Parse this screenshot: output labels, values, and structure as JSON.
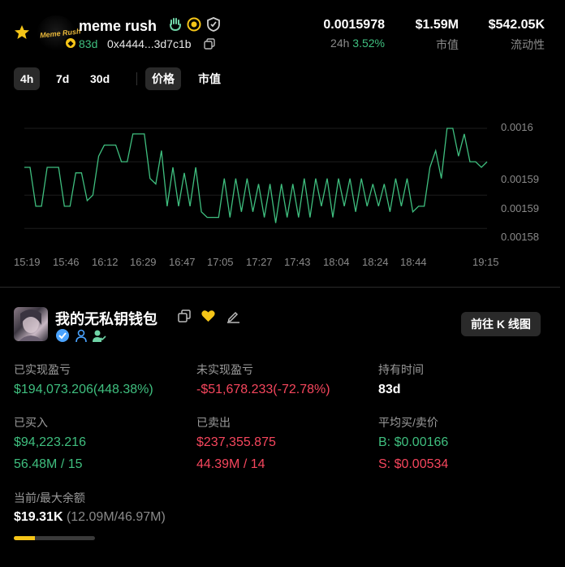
{
  "token": {
    "name": "meme rush",
    "logo_text": "Meme Rush",
    "age": "83d",
    "address": "0x4444...3d7c1b",
    "price": "0.0015978",
    "change_label": "24h",
    "change_value": "3.52%",
    "market_cap": "$1.59M",
    "market_cap_label": "市值",
    "liquidity": "$542.05K",
    "liquidity_label": "流动性"
  },
  "tabs": {
    "intervals": [
      "4h",
      "7d",
      "30d"
    ],
    "active_interval": "4h",
    "metrics": [
      "价格",
      "市值"
    ],
    "active_metric": "价格"
  },
  "chart_data": {
    "type": "line",
    "x_ticks": [
      "15:19",
      "15:46",
      "16:12",
      "16:29",
      "16:47",
      "17:05",
      "17:27",
      "17:43",
      "18:04",
      "18:24",
      "18:44",
      "19:15"
    ],
    "y_ticks": [
      "0.0016",
      "0.00159",
      "0.00159",
      "0.00158"
    ],
    "y_tick_values": [
      0.0016,
      0.001594,
      0.001588,
      0.001582
    ],
    "ylim": [
      0.00158,
      0.0016
    ],
    "line_color": "#3fbf7f",
    "values": [
      0.001593,
      0.001593,
      0.001586,
      0.001586,
      0.001593,
      0.001593,
      0.001593,
      0.001586,
      0.001586,
      0.001592,
      0.001592,
      0.001587,
      0.001588,
      0.001595,
      0.001597,
      0.001597,
      0.001597,
      0.001594,
      0.001594,
      0.001599,
      0.001599,
      0.001599,
      0.001591,
      0.00159,
      0.001596,
      0.001586,
      0.001593,
      0.001586,
      0.001592,
      0.001586,
      0.001593,
      0.001585,
      0.001584,
      0.001584,
      0.001584,
      0.001591,
      0.001584,
      0.001591,
      0.001585,
      0.001591,
      0.001585,
      0.00159,
      0.001584,
      0.00159,
      0.001583,
      0.00159,
      0.001584,
      0.00159,
      0.001584,
      0.001591,
      0.001584,
      0.001591,
      0.001586,
      0.001591,
      0.001584,
      0.001591,
      0.001586,
      0.001591,
      0.001585,
      0.001591,
      0.001586,
      0.00159,
      0.001586,
      0.00159,
      0.001585,
      0.001591,
      0.001586,
      0.001591,
      0.001585,
      0.001586,
      0.001586,
      0.001593,
      0.001596,
      0.001591,
      0.0016,
      0.0016,
      0.001595,
      0.001599,
      0.001594,
      0.001594,
      0.001593,
      0.001594
    ]
  },
  "wallet": {
    "name": "我的无私钥钱包",
    "kline_button": "前往 K 线图",
    "realized_pnl_label": "已实现盈亏",
    "realized_pnl": "$194,073.206(448.38%)",
    "unrealized_pnl_label": "未实现盈亏",
    "unrealized_pnl": "-$51,678.233(-72.78%)",
    "hold_time_label": "持有时间",
    "hold_time": "83d",
    "bought_label": "已买入",
    "bought_value": "$94,223.216",
    "bought_amount": "56.48M / 15",
    "sold_label": "已卖出",
    "sold_value": "$237,355.875",
    "sold_amount": "44.39M / 14",
    "avg_label": "平均买/卖价",
    "avg_buy": "B: $0.00166",
    "avg_sell": "S: $0.00534",
    "balance_label": "当前/最大余额",
    "balance_value": "$19.31K",
    "balance_detail": "(12.09M/46.97M)",
    "balance_ratio": 0.257
  },
  "colors": {
    "up": "#3fbf7f",
    "down": "#f6465d",
    "accent": "#f5c518"
  }
}
